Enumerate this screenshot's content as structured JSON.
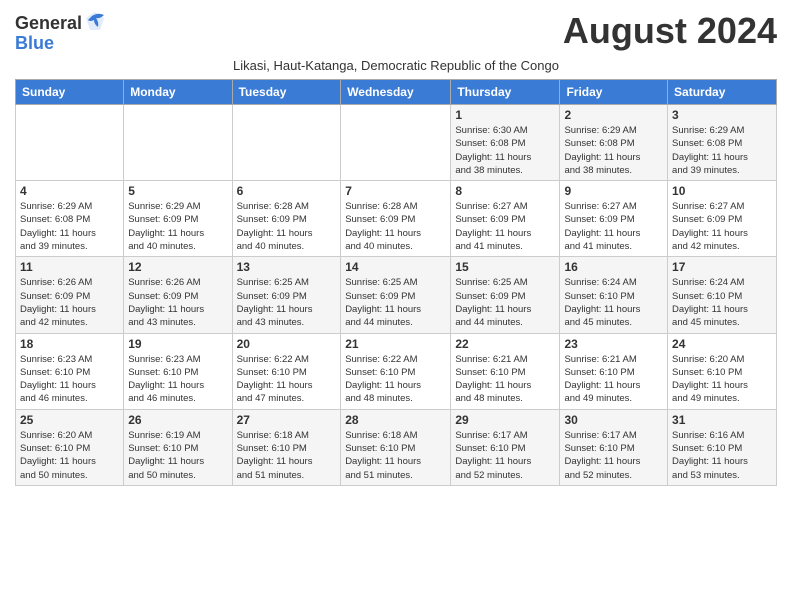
{
  "header": {
    "logo_general": "General",
    "logo_blue": "Blue",
    "month_title": "August 2024",
    "subtitle": "Likasi, Haut-Katanga, Democratic Republic of the Congo"
  },
  "days_of_week": [
    "Sunday",
    "Monday",
    "Tuesday",
    "Wednesday",
    "Thursday",
    "Friday",
    "Saturday"
  ],
  "weeks": [
    [
      {
        "day": "",
        "info": ""
      },
      {
        "day": "",
        "info": ""
      },
      {
        "day": "",
        "info": ""
      },
      {
        "day": "",
        "info": ""
      },
      {
        "day": "1",
        "info": "Sunrise: 6:30 AM\nSunset: 6:08 PM\nDaylight: 11 hours\nand 38 minutes."
      },
      {
        "day": "2",
        "info": "Sunrise: 6:29 AM\nSunset: 6:08 PM\nDaylight: 11 hours\nand 38 minutes."
      },
      {
        "day": "3",
        "info": "Sunrise: 6:29 AM\nSunset: 6:08 PM\nDaylight: 11 hours\nand 39 minutes."
      }
    ],
    [
      {
        "day": "4",
        "info": "Sunrise: 6:29 AM\nSunset: 6:08 PM\nDaylight: 11 hours\nand 39 minutes."
      },
      {
        "day": "5",
        "info": "Sunrise: 6:29 AM\nSunset: 6:09 PM\nDaylight: 11 hours\nand 40 minutes."
      },
      {
        "day": "6",
        "info": "Sunrise: 6:28 AM\nSunset: 6:09 PM\nDaylight: 11 hours\nand 40 minutes."
      },
      {
        "day": "7",
        "info": "Sunrise: 6:28 AM\nSunset: 6:09 PM\nDaylight: 11 hours\nand 40 minutes."
      },
      {
        "day": "8",
        "info": "Sunrise: 6:27 AM\nSunset: 6:09 PM\nDaylight: 11 hours\nand 41 minutes."
      },
      {
        "day": "9",
        "info": "Sunrise: 6:27 AM\nSunset: 6:09 PM\nDaylight: 11 hours\nand 41 minutes."
      },
      {
        "day": "10",
        "info": "Sunrise: 6:27 AM\nSunset: 6:09 PM\nDaylight: 11 hours\nand 42 minutes."
      }
    ],
    [
      {
        "day": "11",
        "info": "Sunrise: 6:26 AM\nSunset: 6:09 PM\nDaylight: 11 hours\nand 42 minutes."
      },
      {
        "day": "12",
        "info": "Sunrise: 6:26 AM\nSunset: 6:09 PM\nDaylight: 11 hours\nand 43 minutes."
      },
      {
        "day": "13",
        "info": "Sunrise: 6:25 AM\nSunset: 6:09 PM\nDaylight: 11 hours\nand 43 minutes."
      },
      {
        "day": "14",
        "info": "Sunrise: 6:25 AM\nSunset: 6:09 PM\nDaylight: 11 hours\nand 44 minutes."
      },
      {
        "day": "15",
        "info": "Sunrise: 6:25 AM\nSunset: 6:09 PM\nDaylight: 11 hours\nand 44 minutes."
      },
      {
        "day": "16",
        "info": "Sunrise: 6:24 AM\nSunset: 6:10 PM\nDaylight: 11 hours\nand 45 minutes."
      },
      {
        "day": "17",
        "info": "Sunrise: 6:24 AM\nSunset: 6:10 PM\nDaylight: 11 hours\nand 45 minutes."
      }
    ],
    [
      {
        "day": "18",
        "info": "Sunrise: 6:23 AM\nSunset: 6:10 PM\nDaylight: 11 hours\nand 46 minutes."
      },
      {
        "day": "19",
        "info": "Sunrise: 6:23 AM\nSunset: 6:10 PM\nDaylight: 11 hours\nand 46 minutes."
      },
      {
        "day": "20",
        "info": "Sunrise: 6:22 AM\nSunset: 6:10 PM\nDaylight: 11 hours\nand 47 minutes."
      },
      {
        "day": "21",
        "info": "Sunrise: 6:22 AM\nSunset: 6:10 PM\nDaylight: 11 hours\nand 48 minutes."
      },
      {
        "day": "22",
        "info": "Sunrise: 6:21 AM\nSunset: 6:10 PM\nDaylight: 11 hours\nand 48 minutes."
      },
      {
        "day": "23",
        "info": "Sunrise: 6:21 AM\nSunset: 6:10 PM\nDaylight: 11 hours\nand 49 minutes."
      },
      {
        "day": "24",
        "info": "Sunrise: 6:20 AM\nSunset: 6:10 PM\nDaylight: 11 hours\nand 49 minutes."
      }
    ],
    [
      {
        "day": "25",
        "info": "Sunrise: 6:20 AM\nSunset: 6:10 PM\nDaylight: 11 hours\nand 50 minutes."
      },
      {
        "day": "26",
        "info": "Sunrise: 6:19 AM\nSunset: 6:10 PM\nDaylight: 11 hours\nand 50 minutes."
      },
      {
        "day": "27",
        "info": "Sunrise: 6:18 AM\nSunset: 6:10 PM\nDaylight: 11 hours\nand 51 minutes."
      },
      {
        "day": "28",
        "info": "Sunrise: 6:18 AM\nSunset: 6:10 PM\nDaylight: 11 hours\nand 51 minutes."
      },
      {
        "day": "29",
        "info": "Sunrise: 6:17 AM\nSunset: 6:10 PM\nDaylight: 11 hours\nand 52 minutes."
      },
      {
        "day": "30",
        "info": "Sunrise: 6:17 AM\nSunset: 6:10 PM\nDaylight: 11 hours\nand 52 minutes."
      },
      {
        "day": "31",
        "info": "Sunrise: 6:16 AM\nSunset: 6:10 PM\nDaylight: 11 hours\nand 53 minutes."
      }
    ]
  ]
}
